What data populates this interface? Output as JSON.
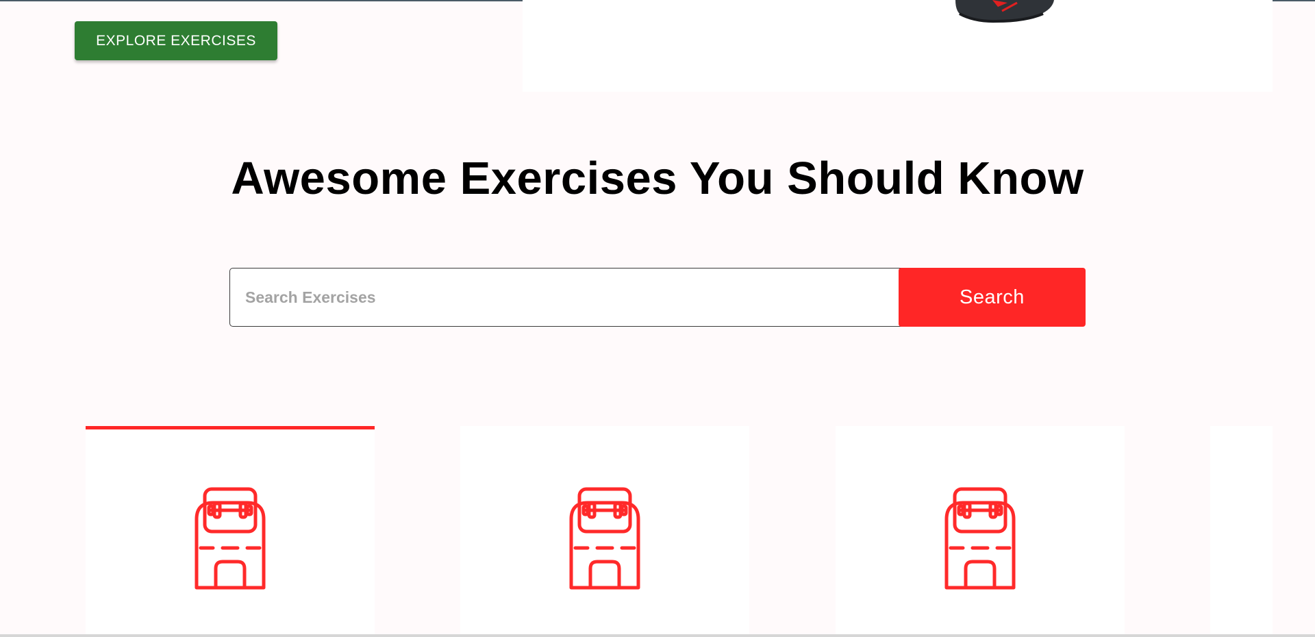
{
  "hero": {
    "explore_button_label": "EXPLORE EXERCISES"
  },
  "exercises_section": {
    "title": "Awesome Exercises You Should Know"
  },
  "search": {
    "placeholder": "Search Exercises",
    "value": "",
    "button_label": "Search"
  },
  "body_part_cards": [
    {
      "icon": "gym-icon",
      "selected": true
    },
    {
      "icon": "gym-icon",
      "selected": false
    },
    {
      "icon": "gym-icon",
      "selected": false
    },
    {
      "icon": "gym-icon",
      "selected": false
    }
  ],
  "colors": {
    "accent": "#ff2626",
    "explore_button": "#2e7d32",
    "page_background": "#fffafb",
    "card_background": "#ffffff"
  }
}
